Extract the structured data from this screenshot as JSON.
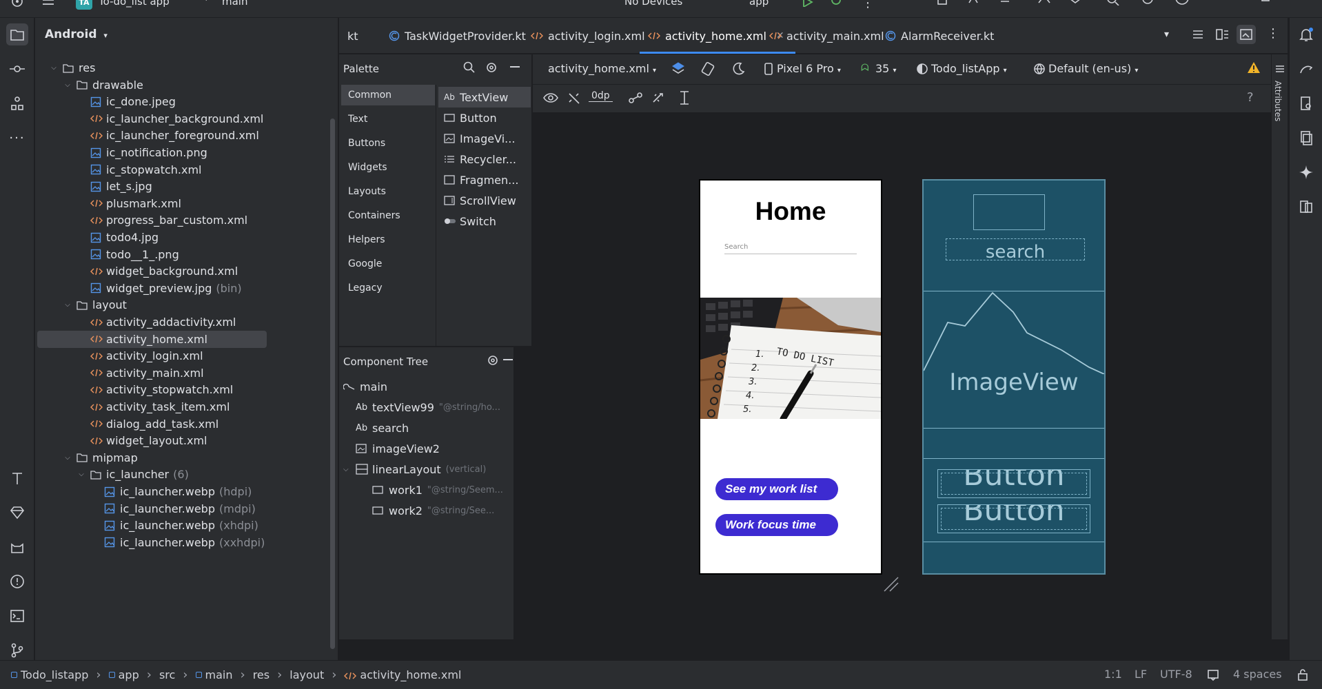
{
  "topbar": {
    "project_badge": "TA",
    "project_name": "To-do_list app",
    "branch": "main",
    "device": "No Devices",
    "run_config": "app"
  },
  "project_panel": {
    "view_mode": "Android",
    "tree": [
      {
        "label": "res",
        "depth": 1,
        "type": "folder",
        "expanded": true
      },
      {
        "label": "drawable",
        "depth": 2,
        "type": "folder",
        "expanded": true
      },
      {
        "label": "ic_done.jpeg",
        "depth": 3,
        "type": "img"
      },
      {
        "label": "ic_launcher_background.xml",
        "depth": 3,
        "type": "xml"
      },
      {
        "label": "ic_launcher_foreground.xml",
        "depth": 3,
        "type": "xml"
      },
      {
        "label": "ic_notification.png",
        "depth": 3,
        "type": "img"
      },
      {
        "label": "ic_stopwatch.xml",
        "depth": 3,
        "type": "img"
      },
      {
        "label": "let_s.jpg",
        "depth": 3,
        "type": "img"
      },
      {
        "label": "plusmark.xml",
        "depth": 3,
        "type": "xml"
      },
      {
        "label": "progress_bar_custom.xml",
        "depth": 3,
        "type": "xml"
      },
      {
        "label": "todo4.jpg",
        "depth": 3,
        "type": "img"
      },
      {
        "label": "todo__1_.png",
        "depth": 3,
        "type": "img"
      },
      {
        "label": "widget_background.xml",
        "depth": 3,
        "type": "xml"
      },
      {
        "label": "widget_preview.jpg",
        "hint": "(bin)",
        "depth": 3,
        "type": "img"
      },
      {
        "label": "layout",
        "depth": 2,
        "type": "folder",
        "expanded": true
      },
      {
        "label": "activity_addactivity.xml",
        "depth": 3,
        "type": "xml"
      },
      {
        "label": "activity_home.xml",
        "depth": 3,
        "type": "xml",
        "selected": true
      },
      {
        "label": "activity_login.xml",
        "depth": 3,
        "type": "xml"
      },
      {
        "label": "activity_main.xml",
        "depth": 3,
        "type": "xml"
      },
      {
        "label": "activity_stopwatch.xml",
        "depth": 3,
        "type": "xml"
      },
      {
        "label": "activity_task_item.xml",
        "depth": 3,
        "type": "xml"
      },
      {
        "label": "dialog_add_task.xml",
        "depth": 3,
        "type": "xml"
      },
      {
        "label": "widget_layout.xml",
        "depth": 3,
        "type": "xml"
      },
      {
        "label": "mipmap",
        "depth": 2,
        "type": "folder",
        "expanded": true
      },
      {
        "label": "ic_launcher",
        "hint": "(6)",
        "depth": 3,
        "type": "folder",
        "expanded": true
      },
      {
        "label": "ic_launcher.webp",
        "hint": "(hdpi)",
        "depth": 4,
        "type": "img"
      },
      {
        "label": "ic_launcher.webp",
        "hint": "(mdpi)",
        "depth": 4,
        "type": "img"
      },
      {
        "label": "ic_launcher.webp",
        "hint": "(xhdpi)",
        "depth": 4,
        "type": "img"
      },
      {
        "label": "ic_launcher.webp",
        "hint": "(xxhdpi)",
        "depth": 4,
        "type": "img"
      }
    ]
  },
  "tabs": [
    {
      "label": "kt",
      "icon": "kotlin-class-icon",
      "active": false
    },
    {
      "label": "TaskWidgetProvider.kt",
      "icon": "kotlin-class-icon",
      "active": false
    },
    {
      "label": "activity_login.xml",
      "icon": "xml-icon",
      "active": false
    },
    {
      "label": "activity_home.xml",
      "icon": "xml-icon",
      "active": true
    },
    {
      "label": "activity_main.xml",
      "icon": "xml-icon",
      "active": false
    },
    {
      "label": "AlarmReceiver.kt",
      "icon": "kotlin-class-icon",
      "active": false
    }
  ],
  "palette": {
    "title": "Palette",
    "categories": [
      "Common",
      "Text",
      "Buttons",
      "Widgets",
      "Layouts",
      "Containers",
      "Helpers",
      "Google",
      "Legacy"
    ],
    "selected_category": "Common",
    "widgets": [
      {
        "label": "TextView",
        "prefix": "Ab"
      },
      {
        "label": "Button"
      },
      {
        "label": "ImageVi..."
      },
      {
        "label": "Recycler..."
      },
      {
        "label": "Fragmen..."
      },
      {
        "label": "ScrollView"
      },
      {
        "label": "Switch"
      }
    ]
  },
  "component_tree": {
    "title": "Component Tree",
    "items": [
      {
        "label": "main",
        "hint": "",
        "depth": 0,
        "icon": "constraint-icon"
      },
      {
        "label": "textView99",
        "hint": "\"@string/ho...",
        "depth": 1,
        "icon": "textview-icon"
      },
      {
        "label": "search",
        "hint": "",
        "depth": 1,
        "icon": "textview-icon"
      },
      {
        "label": "imageView2",
        "hint": "",
        "depth": 1,
        "icon": "image-icon"
      },
      {
        "label": "linearLayout",
        "hint": "(vertical)",
        "depth": 1,
        "icon": "linear-layout-icon",
        "expanded": true
      },
      {
        "label": "work1",
        "hint": "\"@string/Seem...",
        "depth": 2,
        "icon": "button-icon"
      },
      {
        "label": "work2",
        "hint": "\"@string/See...",
        "depth": 2,
        "icon": "button-icon"
      }
    ]
  },
  "design_toolbar": {
    "file": "activity_home.xml",
    "device": "Pixel 6 Pro",
    "api": "35",
    "theme": "Todo_listApp",
    "locale": "Default (en-us)",
    "margin": "0dp"
  },
  "preview": {
    "title": "Home",
    "search_placeholder": "Search",
    "note_text": "TO DO LIST",
    "note_numbers": [
      "1.",
      "2.",
      "3.",
      "4.",
      "5."
    ],
    "button1": "See my work list",
    "button2": "Work focus time",
    "button_color": "#3d2bd1"
  },
  "blueprint": {
    "search_label": "search",
    "image_label": "ImageView",
    "button_label": "Button",
    "color": "#1d5166"
  },
  "right_panel": {
    "attributes_label": "Attributes"
  },
  "statusbar": {
    "breadcrumbs": [
      "Todo_listapp",
      "app",
      "src",
      "main",
      "res",
      "layout",
      "activity_home.xml"
    ],
    "position": "1:1",
    "line_sep": "LF",
    "encoding": "UTF-8",
    "indent": "4 spaces"
  }
}
